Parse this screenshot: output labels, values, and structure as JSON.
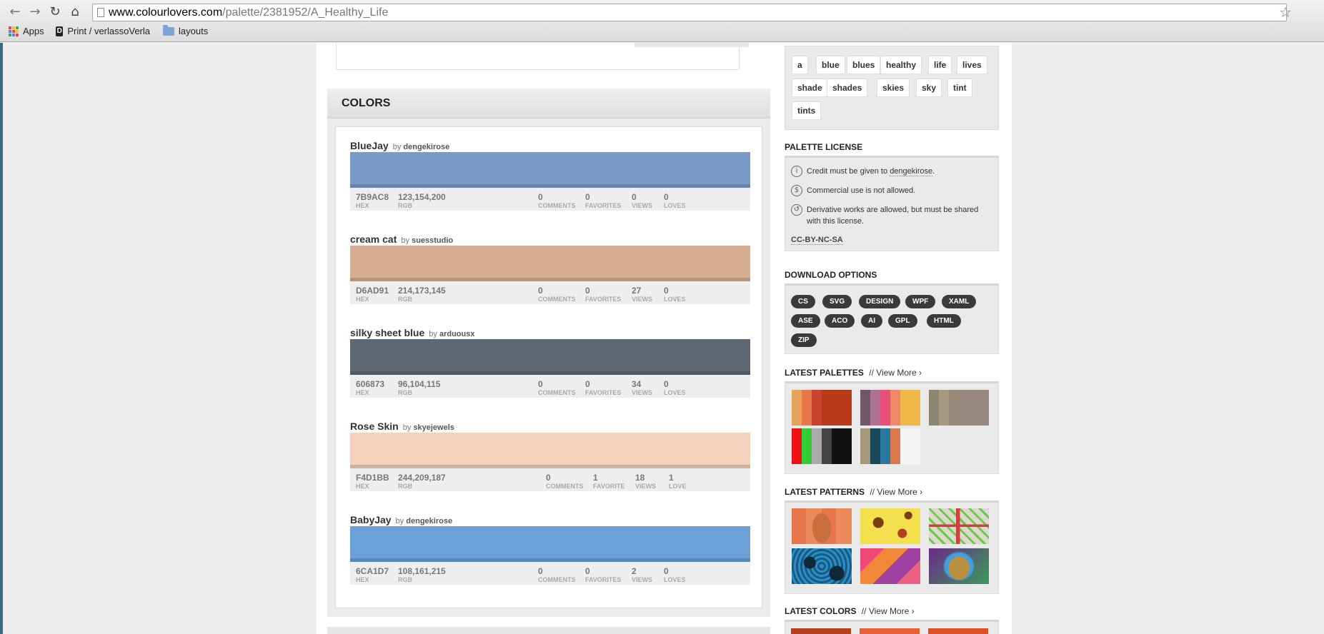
{
  "browser": {
    "url_host": "www.colourlovers.com",
    "url_path": "/palette/2381952/A_Healthy_Life",
    "bookmarks": [
      {
        "label": "Apps"
      },
      {
        "label": "Print / verlassoVerla"
      },
      {
        "label": "layouts"
      }
    ]
  },
  "colors": {
    "title": "COLORS",
    "by_prefix": "by",
    "items": [
      {
        "name": "BlueJay",
        "author": "dengekirose",
        "color": "#7B9AC8",
        "hex": "7B9AC8",
        "hex_label": "HEX",
        "rgb": "123,154,200",
        "rgb_label": "RGB",
        "comments": "0",
        "comments_label": "COMMENTS",
        "favorites": "0",
        "favorites_label": "FAVORITES",
        "views": "0",
        "views_label": "VIEWS",
        "loves": "0",
        "loves_label": "LOVES"
      },
      {
        "name": "cream cat",
        "author": "suesstudio",
        "color": "#D6AD91",
        "hex": "D6AD91",
        "hex_label": "HEX",
        "rgb": "214,173,145",
        "rgb_label": "RGB",
        "comments": "0",
        "comments_label": "COMMENTS",
        "favorites": "0",
        "favorites_label": "FAVORITES",
        "views": "27",
        "views_label": "VIEWS",
        "loves": "0",
        "loves_label": "LOVES"
      },
      {
        "name": "silky sheet blue",
        "author": "arduousx",
        "color": "#606873",
        "hex": "606873",
        "hex_label": "HEX",
        "rgb": "96,104,115",
        "rgb_label": "RGB",
        "comments": "0",
        "comments_label": "COMMENTS",
        "favorites": "0",
        "favorites_label": "FAVORITES",
        "views": "34",
        "views_label": "VIEWS",
        "loves": "0",
        "loves_label": "LOVES"
      },
      {
        "name": "Rose Skin",
        "author": "skyejewels",
        "color": "#F4D1BB",
        "hex": "F4D1BB",
        "hex_label": "HEX",
        "rgb": "244,209,187",
        "rgb_label": "RGB",
        "comments": "0",
        "comments_label": "COMMENTS",
        "favorites": "1",
        "favorites_label": "FAVORITE",
        "views": "18",
        "views_label": "VIEWS",
        "loves": "1",
        "loves_label": "LOVE"
      },
      {
        "name": "BabyJay",
        "author": "dengekirose",
        "color": "#6CA1D7",
        "hex": "6CA1D7",
        "hex_label": "HEX",
        "rgb": "108,161,215",
        "rgb_label": "RGB",
        "comments": "0",
        "comments_label": "COMMENTS",
        "favorites": "0",
        "favorites_label": "FAVORITES",
        "views": "2",
        "views_label": "VIEWS",
        "loves": "0",
        "loves_label": "LOVES"
      }
    ]
  },
  "tags": [
    "a",
    "blue",
    "blues",
    "healthy",
    "life",
    "lives",
    "shade",
    "shades",
    "skies",
    "sky",
    "tint",
    "tints"
  ],
  "license": {
    "title": "PALETTE LICENSE",
    "credit_prefix": "Credit must be given to",
    "credit_user": "dengekirose",
    "credit_suffix": ".",
    "commercial": "Commercial use is not allowed.",
    "derivative": "Derivative works are allowed, but must be shared with this license.",
    "code": "CC-BY-NC-SA"
  },
  "download": {
    "title": "DOWNLOAD OPTIONS",
    "options": [
      "CS",
      "SVG",
      "DESIGN",
      "WPF",
      "XAML",
      "ASE",
      "ACO",
      "AI",
      "GPL",
      "HTML",
      "ZIP"
    ]
  },
  "latest_palettes": {
    "title": "LATEST PALETTES",
    "separator": "//",
    "view_more": "View More ›",
    "palettes": [
      [
        "#E8A45C",
        "#E8784C",
        "#C8442C",
        "#B83A18",
        "#B83A18"
      ],
      [
        "#705868",
        "#B07090",
        "#E8507A",
        "#F08868",
        "#F0B848"
      ],
      [
        "#888870",
        "#A89880",
        "#988878",
        "#988880",
        "#988880"
      ],
      [
        "#EE1111",
        "#33CC33",
        "#AAAAAA",
        "#444444",
        "#111111"
      ],
      [
        "#A89878",
        "#184858",
        "#2878A0",
        "#D8784C",
        "#F4F4F4"
      ]
    ]
  },
  "latest_patterns": {
    "title": "LATEST PATTERNS",
    "separator": "//",
    "view_more": "View More ›"
  },
  "latest_colors": {
    "title": "LATEST COLORS",
    "separator": "//",
    "view_more": "View More ›",
    "colors": [
      "#B84020",
      "#E86038",
      "#E05028"
    ]
  }
}
